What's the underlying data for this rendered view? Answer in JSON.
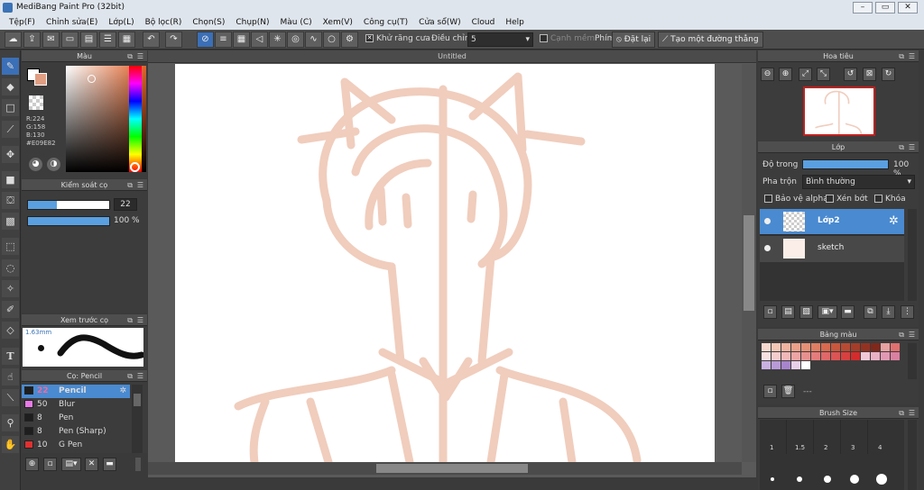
{
  "window": {
    "title": "MediBang Paint Pro (32bit)",
    "min_icon": "minimize-icon",
    "max_icon": "maximize-icon",
    "close_icon": "close-icon"
  },
  "menu": [
    "Tệp(F)",
    "Chỉnh sửa(E)",
    "Lớp(L)",
    "Bộ lọc(R)",
    "Chọn(S)",
    "Chụp(N)",
    "Màu (C)",
    "Xem(V)",
    "Công cụ(T)",
    "Cửa sổ(W)",
    "Cloud",
    "Help"
  ],
  "toolbar": {
    "antialias_label": "Khử răng cưa",
    "adjust_label": "Điều chỉnh",
    "adjust_value": "5",
    "smooth_label": "Cạnh mềm",
    "keyboard_label": "Phím",
    "reset_label": "Đặt lại",
    "create_line_label": "Tạo một đường thẳng"
  },
  "color_panel": {
    "title": "Màu",
    "r": "R:224",
    "g": "G:158",
    "b": "B:130",
    "hex": "#E09E82",
    "primary_color": "#E09E82",
    "secondary_color": "#ffffff"
  },
  "brush_control": {
    "title": "Kiểm soát cọ",
    "size_value": "22",
    "opacity_value": "100 %",
    "size_fraction": 0.35,
    "opacity_fraction": 1.0
  },
  "brush_preview": {
    "title": "Xem trước cọ",
    "size_text": "1.63mm"
  },
  "brush_list": {
    "title": "Cọ: Pencil",
    "items": [
      {
        "size": "22",
        "name": "Pencil",
        "color": "#1e1e1e",
        "selected": true
      },
      {
        "size": "50",
        "name": "Blur",
        "color": "#e879e8",
        "selected": false
      },
      {
        "size": "8",
        "name": "Pen",
        "color": "#1e1e1e",
        "selected": false
      },
      {
        "size": "8",
        "name": "Pen (Sharp)",
        "color": "#1e1e1e",
        "selected": false
      },
      {
        "size": "10",
        "name": "G Pen",
        "color": "#e03030",
        "selected": false
      }
    ]
  },
  "document": {
    "title": "Untitled"
  },
  "navigator": {
    "title": "Hoa tiêu"
  },
  "layer_panel": {
    "title": "Lớp",
    "opacity_label": "Độ trong",
    "opacity_value": "100 %",
    "opacity_fraction": 1.0,
    "blend_label": "Pha trộn",
    "blend_value": "Bình thường",
    "protect_alpha": "Bảo vệ alpha",
    "clipping": "Xén bớt",
    "lock": "Khóa",
    "layers": [
      {
        "name": "Lớp2",
        "selected": true
      },
      {
        "name": "sketch",
        "selected": false
      }
    ]
  },
  "color_swatch_panel": {
    "title": "Bảng màu",
    "footer": "---"
  },
  "brush_size_panel": {
    "title": "Brush Size",
    "labels": [
      "1",
      "1.5",
      "2",
      "3",
      "4"
    ]
  }
}
